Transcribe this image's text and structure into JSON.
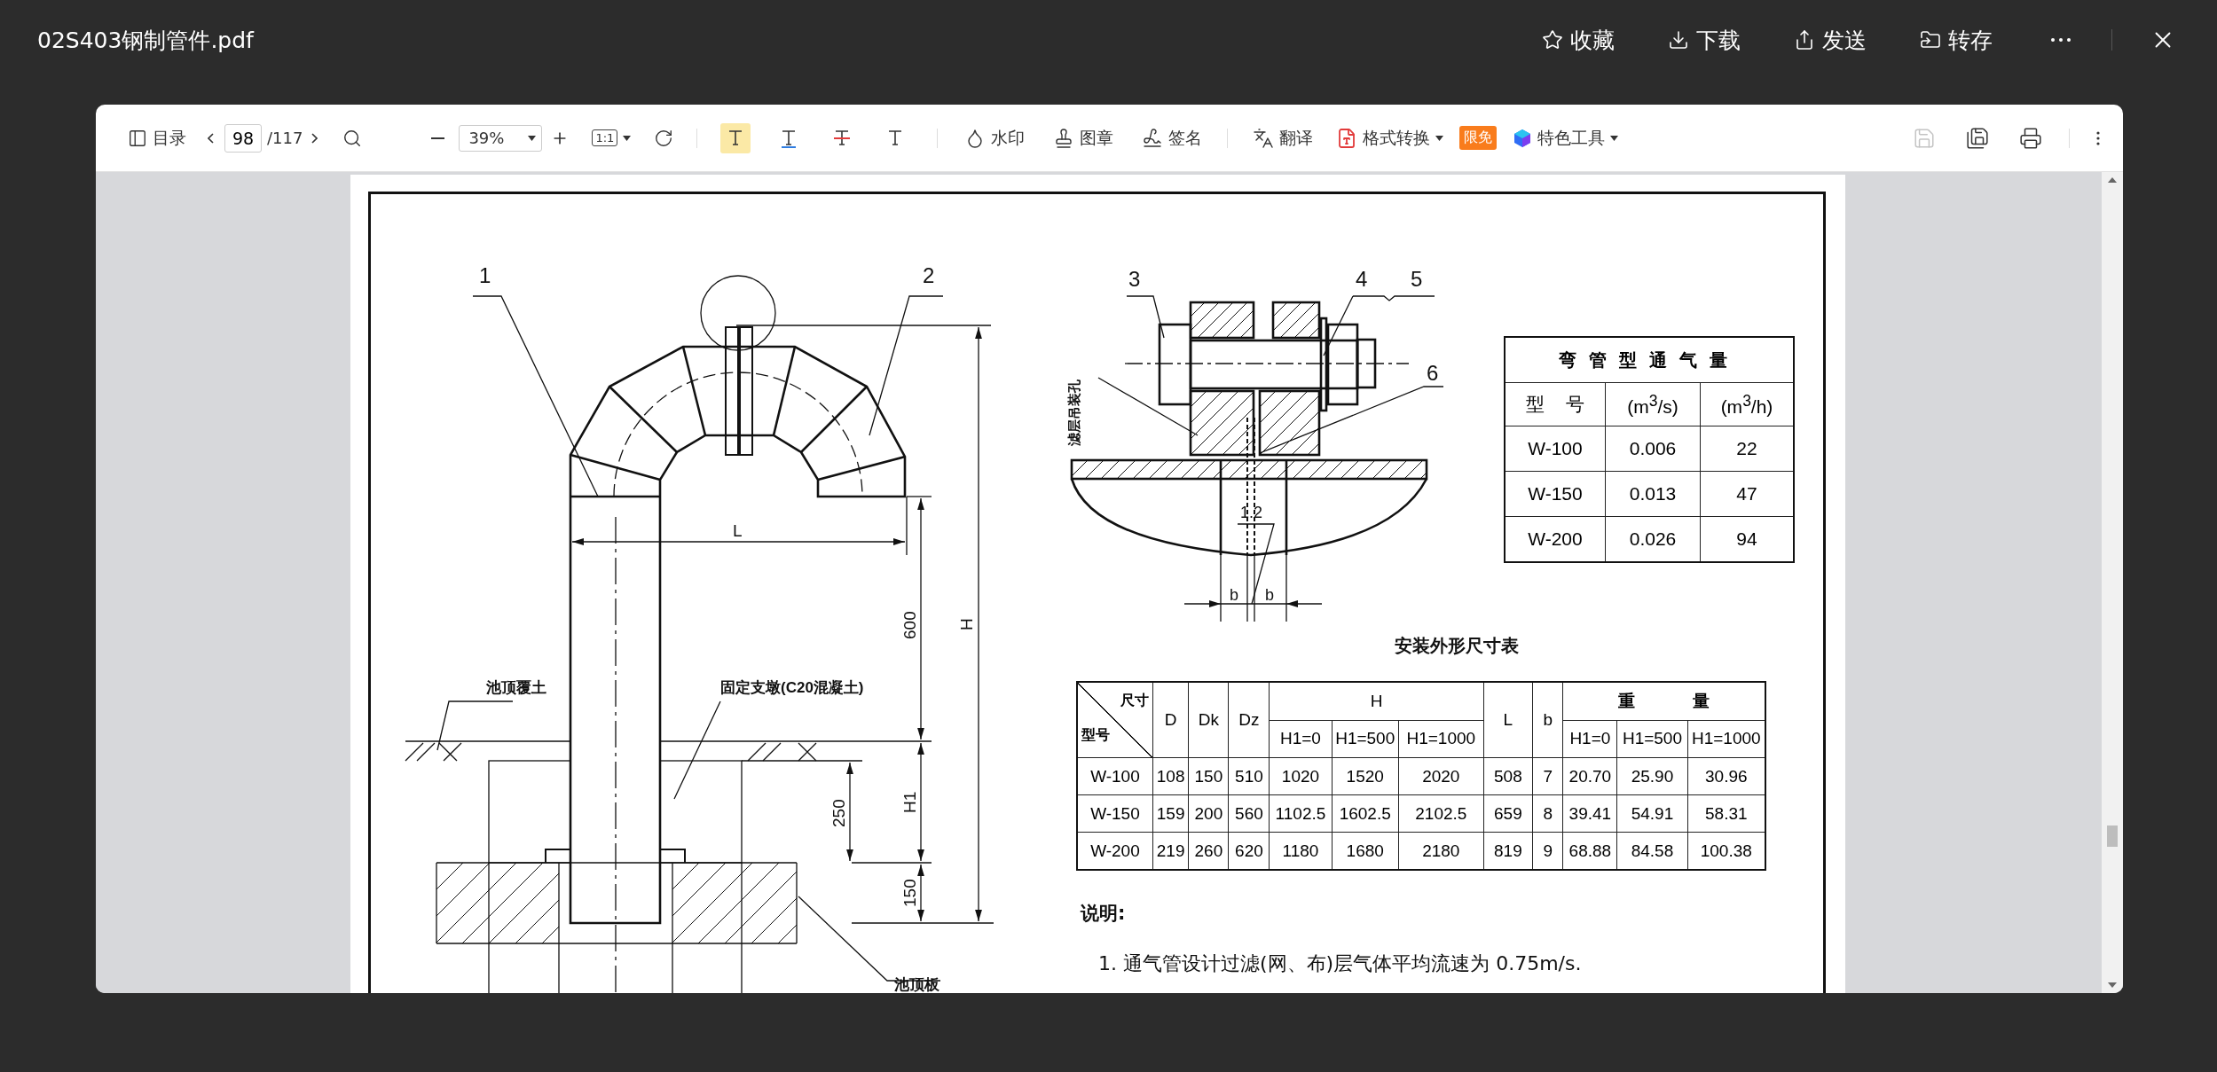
{
  "title": "02S403钢制管件.pdf",
  "header_actions": [
    {
      "label": "收藏",
      "kind": "star"
    },
    {
      "label": "下载",
      "kind": "download"
    },
    {
      "label": "发送",
      "kind": "send"
    },
    {
      "label": "转存",
      "kind": "transfer"
    }
  ],
  "toolbar": {
    "toc_label": "目录",
    "page": {
      "current": "98",
      "total": "/117"
    },
    "zoom": "39%",
    "actual_size": "1:1",
    "text_tools": [
      {
        "kind": "highlight",
        "selected": true
      },
      {
        "kind": "underline",
        "selected": false
      },
      {
        "kind": "strikethrough",
        "selected": false
      },
      {
        "kind": "plain",
        "selected": false
      }
    ],
    "tools": [
      {
        "label": "水印",
        "kind": "watermark"
      },
      {
        "label": "图章",
        "kind": "stamp"
      },
      {
        "label": "签名",
        "kind": "sign"
      }
    ],
    "translate": "翻译",
    "convert": "格式转换",
    "badge": "限免",
    "special": "特色工具",
    "file_actions": [
      {
        "kind": "save",
        "disabled": true
      },
      {
        "kind": "save_as",
        "disabled": false
      },
      {
        "kind": "print",
        "disabled": false
      }
    ]
  },
  "drawing": {
    "elevation_labels": [
      "1",
      "2",
      "L",
      "600",
      "H",
      "H1",
      "250",
      "150",
      "池顶覆土",
      "固定支墩(C20混凝土)",
      "池顶板"
    ],
    "detail_labels": [
      "3",
      "4",
      "5",
      "6",
      "1.2",
      "b",
      "b",
      "滤层吊装孔"
    ]
  },
  "airflow_table": {
    "title": "弯管型通气量",
    "columns": [
      "型 号",
      "(m$^{3}$/s)",
      "(m$^{3}$/h)"
    ],
    "rows": [
      [
        "W-100",
        "0.006",
        "22"
      ],
      [
        "W-150",
        "0.013",
        "47"
      ],
      [
        "W-200",
        "0.026",
        "94"
      ]
    ]
  },
  "size_table": {
    "title": "安装外形尺寸表",
    "header_rows": [
      [
        {
          "corner_top": "尺寸",
          "corner_bottom": "型号",
          "rowspan": 2
        },
        {
          "text": "D",
          "rowspan": 2
        },
        {
          "text": "Dk",
          "rowspan": 2
        },
        {
          "text": "Dz",
          "rowspan": 2
        },
        {
          "text": "H",
          "colspan": 3
        },
        {
          "text": "L",
          "rowspan": 2
        },
        {
          "text": "b",
          "rowspan": 2
        },
        {
          "text": "重 量",
          "colspan": 3
        }
      ],
      [
        {
          "text": "H1=0"
        },
        {
          "text": "H1=500"
        },
        {
          "text": "H1=1000"
        },
        {
          "text": "H1=0"
        },
        {
          "text": "H1=500"
        },
        {
          "text": "H1=1000"
        }
      ]
    ],
    "rows": [
      [
        "W-100",
        "108",
        "150",
        "510",
        "1020",
        "1520",
        "2020",
        "508",
        "7",
        "20.70",
        "25.90",
        "30.96"
      ],
      [
        "W-150",
        "159",
        "200",
        "560",
        "1102.5",
        "1602.5",
        "2102.5",
        "659",
        "8",
        "39.41",
        "54.91",
        "58.31"
      ],
      [
        "W-200",
        "219",
        "260",
        "620",
        "1180",
        "1680",
        "2180",
        "819",
        "9",
        "68.88",
        "84.58",
        "100.38"
      ]
    ]
  },
  "notes": {
    "heading": "说明:",
    "items": [
      "1. 通气管设计过滤(网、布)层气体平均流速为 0.75m/s."
    ]
  }
}
